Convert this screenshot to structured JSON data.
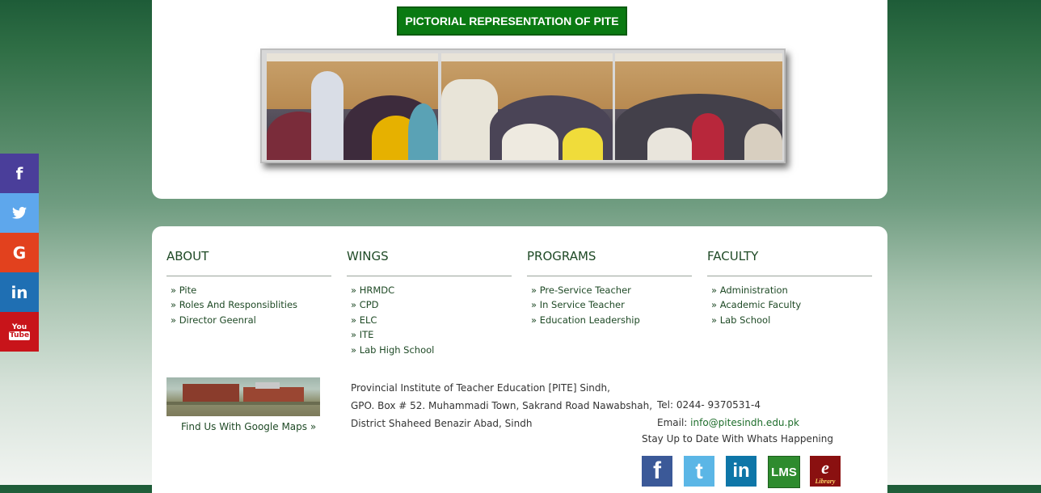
{
  "social_bar": {
    "facebook": "f",
    "twitter": "twitter-bird",
    "google": "G",
    "linkedin": "in",
    "youtube_top": "You",
    "youtube_bottom": "Tube"
  },
  "gallery": {
    "title": "PICTORIAL REPRESENTATION OF PITE"
  },
  "footer": {
    "columns": [
      {
        "heading": "ABOUT",
        "links": [
          "» Pite",
          "» Roles And Responsiblities",
          "» Director Geenral"
        ]
      },
      {
        "heading": "WINGS",
        "links": [
          "» HRMDC",
          "» CPD",
          "» ELC",
          "» ITE",
          "» Lab High School"
        ]
      },
      {
        "heading": "PROGRAMS",
        "links": [
          "» Pre-Service Teacher",
          "» In Service Teacher",
          "» Education Leadership"
        ]
      },
      {
        "heading": "FACULTY",
        "links": [
          "» Administration",
          "» Academic Faculty",
          "» Lab School"
        ]
      }
    ],
    "map_link": "Find Us With Google Maps »",
    "address": [
      "Provincial Institute of Teacher Education [PITE] Sindh,",
      "GPO. Box # 52. Muhammadi Town, Sakrand Road Nawabshah,",
      "District Shaheed Benazir Abad, Sindh"
    ],
    "tel": "Tel: 0244- 9370531-4",
    "email_label": "Email: ",
    "email_value": "info@pitesindh.edu.pk",
    "stay_text": "Stay Up to Date With Whats Happening",
    "icons": {
      "facebook": "f",
      "twitter": "t",
      "linkedin": "in",
      "lms": "LMS",
      "elibrary_top": "e",
      "elibrary_bottom": "Library"
    }
  },
  "colors": {
    "title_bg": "#0a7a12",
    "link_green": "#1f4a26"
  }
}
